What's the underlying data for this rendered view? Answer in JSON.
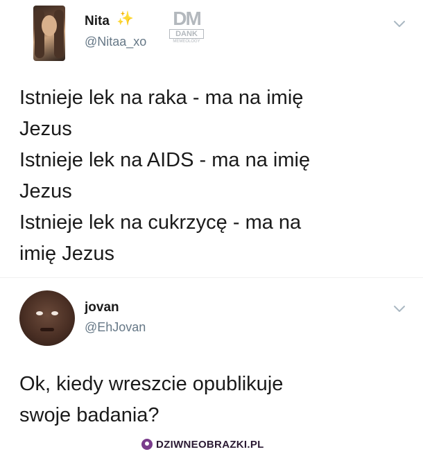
{
  "tweets": [
    {
      "name": "Nita",
      "name_emoji": "✨",
      "handle": "@Nitaa_xo",
      "avatar_icon": "profile-photo",
      "menu_icon": "chevron-down-icon",
      "text": "Istnieje lek na raka - ma na imię\nJezus\nIstnieje lek na AIDS - ma na imię\nJezus\nIstnieje lek na cukrzycę - ma na\nimię Jezus"
    },
    {
      "name": "jovan",
      "handle": "@EhJovan",
      "avatar_icon": "profile-photo",
      "menu_icon": "chevron-down-icon",
      "text": "Ok, kiedy wreszcie opublikuje\nswoje badania?"
    }
  ],
  "watermark": {
    "logo": "DM",
    "line1": "DANK",
    "line2": "MEMEOLOGY"
  },
  "footer": {
    "site_name": "DZIWNEOBRAZKI.PL",
    "logo_color": "#7a3c8c"
  },
  "colors": {
    "text": "#1a1a1a",
    "handle": "#657786",
    "chevron": "#aab8c2"
  }
}
